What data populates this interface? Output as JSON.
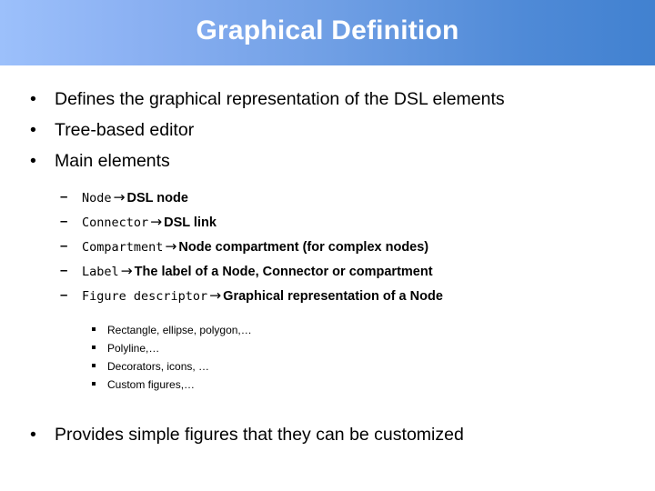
{
  "slide": {
    "title": "Graphical Definition",
    "theme": {
      "banner_gradient_start": "#9cc0fb",
      "banner_gradient_mid": "#6e9ee4",
      "banner_gradient_end": "#4181d0",
      "title_color": "#ffffff",
      "body_text_color": "#000000",
      "background_color": "#ffffff"
    },
    "bullets_top": [
      {
        "marker": "•",
        "text": "Defines the graphical representation of the DSL elements"
      },
      {
        "marker": "•",
        "text": "Tree-based editor"
      },
      {
        "marker": "•",
        "text": "Main elements"
      }
    ],
    "sub_items": [
      {
        "marker": "–",
        "term": "Node",
        "arrow": "→",
        "description": "DSL node"
      },
      {
        "marker": "–",
        "term": "Connector",
        "arrow": "→",
        "description": "DSL link"
      },
      {
        "marker": "–",
        "term": "Compartment",
        "arrow": "→",
        "description": "Node compartment (for complex nodes)"
      },
      {
        "marker": "–",
        "term": "Label",
        "arrow": "→",
        "description": "The label of a Node, Connector or compartment"
      },
      {
        "marker": "–",
        "term": "Figure descriptor",
        "arrow": "→",
        "description": "Graphical representation of a Node"
      }
    ],
    "figure_examples": [
      {
        "text": "Rectangle, ellipse, polygon,…"
      },
      {
        "text": "Polyline,…"
      },
      {
        "text": "Decorators, icons, …"
      },
      {
        "text": "Custom figures,…"
      }
    ],
    "bullets_bottom": [
      {
        "marker": "•",
        "text": "Provides simple figures that they can be customized"
      }
    ]
  }
}
